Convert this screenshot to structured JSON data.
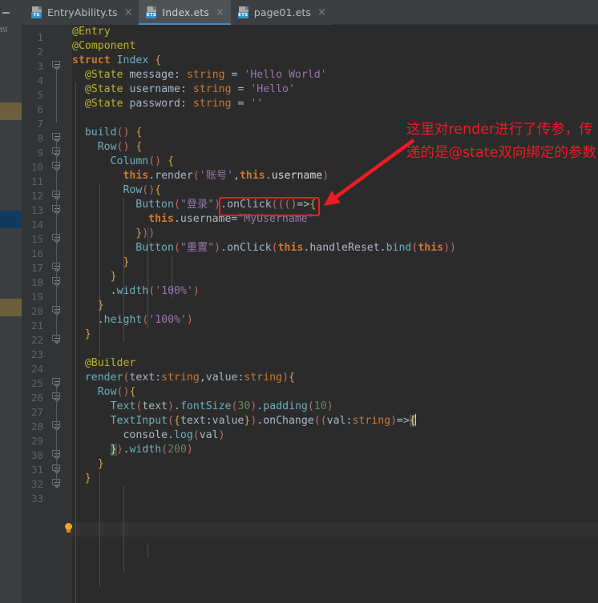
{
  "window": {
    "left_stub_icon": "collapse-dash-icon"
  },
  "tabs": [
    {
      "label": "EntryAbility.ts",
      "badge": "TS",
      "icon": "typescript-file-icon",
      "close": "×",
      "active": false
    },
    {
      "label": "Index.ets",
      "badge": "ETS",
      "icon": "ets-file-icon",
      "close": "×",
      "active": true
    },
    {
      "label": "page01.ets",
      "badge": "ETS",
      "icon": "ets-file-icon",
      "close": "×",
      "active": false
    }
  ],
  "breadcrumb": "t\\l",
  "editor": {
    "current_line": 28,
    "bulb_line": 28,
    "line_numbers": [
      "1",
      "2",
      "3",
      "4",
      "5",
      "6",
      "7",
      "8",
      "9",
      "10",
      "11",
      "12",
      "13",
      "14",
      "15",
      "16",
      "17",
      "18",
      "19",
      "20",
      "21",
      "22",
      "23",
      "24",
      "25",
      "26",
      "27",
      "28",
      "29",
      "30",
      "31",
      "32",
      "33"
    ],
    "lines": [
      {
        "n": 1,
        "text": "@Entry"
      },
      {
        "n": 2,
        "text": "@Component"
      },
      {
        "n": 3,
        "text": "struct Index {"
      },
      {
        "n": 4,
        "text": "  @State message: string = 'Hello World'"
      },
      {
        "n": 5,
        "text": "  @State username: string = 'Hello'"
      },
      {
        "n": 6,
        "text": "  @State password: string = ''"
      },
      {
        "n": 7,
        "text": ""
      },
      {
        "n": 8,
        "text": "  build() {"
      },
      {
        "n": 9,
        "text": "    Row() {"
      },
      {
        "n": 10,
        "text": "      Column() {"
      },
      {
        "n": 11,
        "text": "        this.render('账号',this.username)"
      },
      {
        "n": 12,
        "text": "        Row(){"
      },
      {
        "n": 13,
        "text": "          Button(\"登录\").onClick((()=>{"
      },
      {
        "n": 14,
        "text": "            this.username=\"MyUsername\""
      },
      {
        "n": 15,
        "text": "          }))"
      },
      {
        "n": 16,
        "text": "          Button(\"重置\").onClick(this.handleReset.bind(this))"
      },
      {
        "n": 17,
        "text": "        }"
      },
      {
        "n": 18,
        "text": "      }"
      },
      {
        "n": 19,
        "text": "      .width('100%')"
      },
      {
        "n": 20,
        "text": "    }"
      },
      {
        "n": 21,
        "text": "    .height('100%')"
      },
      {
        "n": 22,
        "text": "  }"
      },
      {
        "n": 23,
        "text": ""
      },
      {
        "n": 24,
        "text": "  @Builder"
      },
      {
        "n": 25,
        "text": "  render(text:string,value:string){"
      },
      {
        "n": 26,
        "text": "    Row(){"
      },
      {
        "n": 27,
        "text": "      Text(text).fontSize(30).padding(10)"
      },
      {
        "n": 28,
        "text": "      TextInput({text:value}).onChange((val:string)=>{"
      },
      {
        "n": 29,
        "text": "        console.log(val)"
      },
      {
        "n": 30,
        "text": "      }).width(200)"
      },
      {
        "n": 31,
        "text": "    }"
      },
      {
        "n": 32,
        "text": "  }"
      },
      {
        "n": 33,
        "text": ""
      }
    ]
  },
  "annotation": {
    "text": "这里对render进行了传参，传递的是@state双向绑定的参数",
    "color": "#ed1c24",
    "highlighted_code": "this.username",
    "arrow": "arrow-pointing-down-left"
  },
  "colors": {
    "editor_background": "#2b2b2b",
    "gutter_background": "#313335",
    "tabbar_background": "#3c3f41",
    "active_tab_background": "#4e5254",
    "active_tab_underline": "#4a88c7",
    "annotation_red": "#ed1c24",
    "line_number": "#606366",
    "default_text": "#a9b7c6"
  }
}
